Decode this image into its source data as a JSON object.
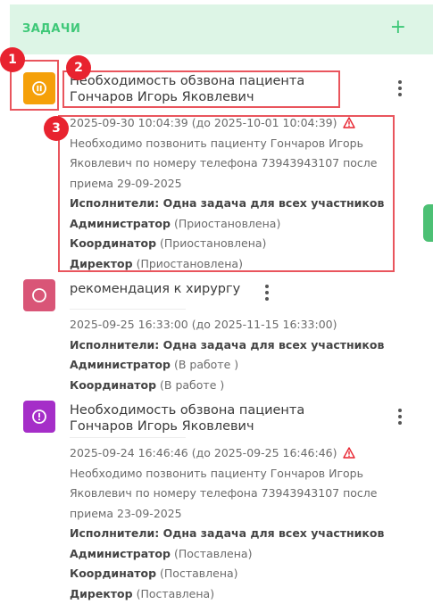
{
  "header": {
    "title": "ЗАДАЧИ",
    "add_icon": "+"
  },
  "colors": {
    "accent": "#3ec878",
    "paused": "#f5a009",
    "in_work": "#d95577",
    "placed": "#a52ec8",
    "warning": "#e8232f"
  },
  "annotations": [
    "1",
    "2",
    "3"
  ],
  "tasks": [
    {
      "status_icon": "pause-icon",
      "title_line1": "Необходимость обзвона пациента",
      "title_line2": "Гончаров Игорь Яковлевич",
      "dates": "2025-09-30 10:04:39 (до 2025-10-01 10:04:39)",
      "overdue": true,
      "desc_line1": "Необходимо позвонить пациенту Гончаров Игорь",
      "desc_line2": "Яковлевич по номеру телефона 73943943107 после",
      "desc_line3": "приема 29-09-2025",
      "executors": "Исполнители: Одна задача для всех участников",
      "roles": [
        {
          "role": "Администратор",
          "state": "(Приостановлена)"
        },
        {
          "role": "Координатор",
          "state": "(Приостановлена)"
        },
        {
          "role": "Директор",
          "state": "(Приостановлена)"
        }
      ]
    },
    {
      "status_icon": "circle-icon",
      "title_line1": "рекомендация к хирургу",
      "dates": "2025-09-25 16:33:00 (до 2025-11-15 16:33:00)",
      "overdue": false,
      "executors": "Исполнители: Одна задача для всех участников",
      "roles": [
        {
          "role": "Администратор",
          "state": "(В работе )"
        },
        {
          "role": "Координатор",
          "state": "(В работе )"
        }
      ]
    },
    {
      "status_icon": "exclamation-icon",
      "title_line1": "Необходимость обзвона пациента",
      "title_line2": "Гончаров Игорь Яковлевич",
      "dates": "2025-09-24 16:46:46 (до 2025-09-25 16:46:46)",
      "overdue": true,
      "desc_line1": "Необходимо позвонить пациенту Гончаров Игорь",
      "desc_line2": "Яковлевич по номеру телефона 73943943107 после",
      "desc_line3": "приема 23-09-2025",
      "executors": "Исполнители: Одна задача для всех участников",
      "roles": [
        {
          "role": "Администратор",
          "state": "(Поставлена)"
        },
        {
          "role": "Координатор",
          "state": "(Поставлена)"
        },
        {
          "role": "Директор",
          "state": "(Поставлена)"
        }
      ]
    }
  ]
}
